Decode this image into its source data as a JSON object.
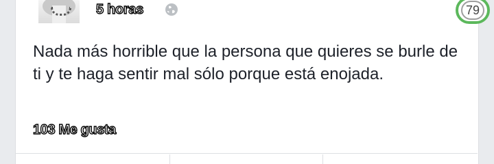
{
  "post": {
    "time": "5 horas",
    "privacy_icon": "globe-icon",
    "text": "Nada más horrible que la persona que quieres se burle de ti y te haga sentir mal sólo porque está enojada.",
    "likes": "103 Me gusta"
  },
  "overlay": {
    "score": "79",
    "ring_color": "#5cb85c"
  }
}
